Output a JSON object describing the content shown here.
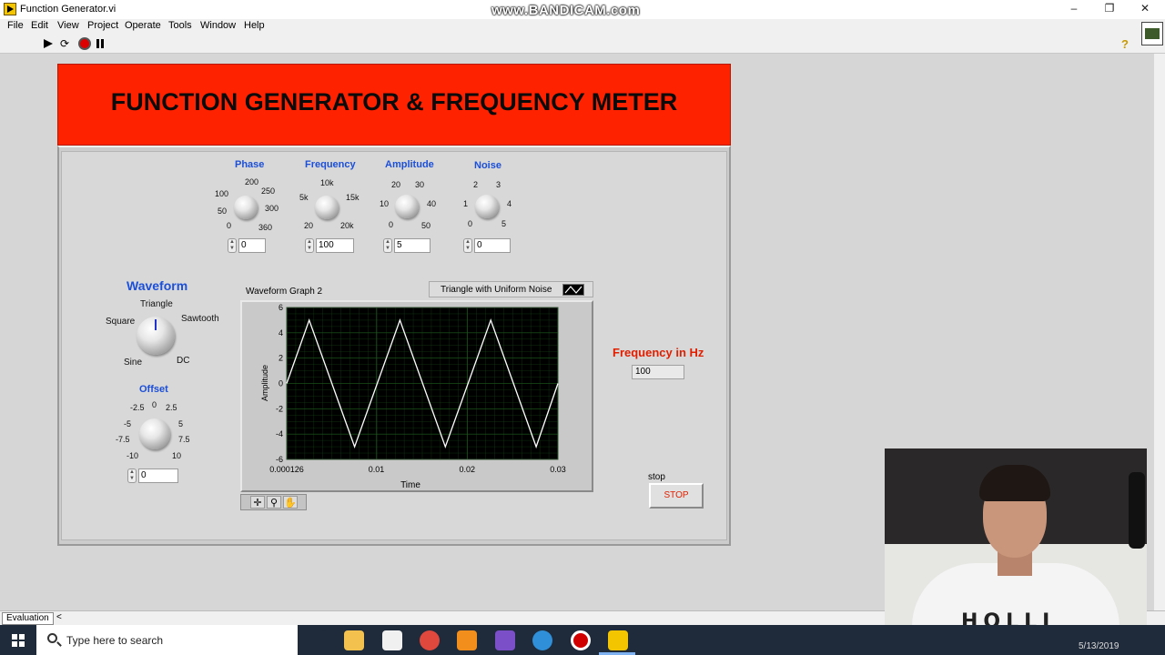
{
  "window": {
    "title": "Function Generator.vi",
    "watermark": "www.BANDICAM.com",
    "controls": [
      "–",
      "❐",
      "✕"
    ]
  },
  "menu": [
    "File",
    "Edit",
    "View",
    "Project",
    "Operate",
    "Tools",
    "Window",
    "Help"
  ],
  "toolbar": {
    "icons": [
      "run-arrow-icon",
      "run-continuously-icon",
      "abort-icon",
      "pause-icon"
    ],
    "help_icon": "?"
  },
  "panel": {
    "header_title": "FUNCTION GENERATOR & FREQUENCY METER",
    "header_color": "#ff2200",
    "knobs": {
      "phase": {
        "label": "Phase",
        "ticks": [
          "0",
          "50",
          "100",
          "200",
          "250",
          "300",
          "360"
        ],
        "value": "0"
      },
      "frequency": {
        "label": "Frequency",
        "ticks": [
          "20",
          "5k",
          "10k",
          "15k",
          "20k"
        ],
        "value": "100"
      },
      "amplitude": {
        "label": "Amplitude",
        "ticks": [
          "0",
          "10",
          "20",
          "30",
          "40",
          "50"
        ],
        "value": "5"
      },
      "noise": {
        "label": "Noise",
        "ticks": [
          "0",
          "1",
          "2",
          "3",
          "4",
          "5"
        ],
        "value": "0"
      }
    },
    "waveform": {
      "label": "Waveform",
      "options": [
        "Sine",
        "Square",
        "Triangle",
        "Sawtooth",
        "DC"
      ],
      "selected": "Triangle"
    },
    "offset": {
      "label": "Offset",
      "ticks": [
        "-10",
        "-7.5",
        "-5",
        "-2.5",
        "0",
        "2.5",
        "5",
        "7.5",
        "10"
      ],
      "value": "0"
    },
    "graph": {
      "caption": "Waveform Graph 2",
      "legend": "Triangle with Uniform Noise",
      "palette_icons": [
        "cursor-icon",
        "zoom-icon",
        "pan-hand-icon"
      ]
    },
    "frequency_indicator": {
      "label": "Frequency in Hz",
      "value": "100"
    },
    "stop": {
      "label": "stop",
      "button": "STOP"
    }
  },
  "chart_data": {
    "type": "line",
    "xlabel": "Time",
    "ylabel": "Amplitude",
    "xlim": [
      0.000126,
      0.03
    ],
    "ylim": [
      -6,
      6
    ],
    "x_ticks": [
      "0.000126",
      "0.01",
      "0.02",
      "0.03"
    ],
    "y_ticks": [
      "6",
      "4",
      "2",
      "0",
      "-2",
      "-4",
      "-6"
    ],
    "grid": true,
    "background": "#000000",
    "line_color": "#ffffff",
    "grid_color": "#1f5c1f",
    "series": [
      {
        "x": [
          0.000126,
          0.0026,
          0.0076,
          0.0126,
          0.0176,
          0.0226,
          0.0276,
          0.03
        ],
        "y": [
          0,
          5,
          -5,
          5,
          -5,
          5,
          -5,
          0
        ]
      }
    ]
  },
  "status": {
    "target": "Evaluation",
    "arrow": "<"
  },
  "taskbar": {
    "search_placeholder": "Type here to search",
    "date": "5/13/2019",
    "apps": [
      "task-view-icon",
      "file-explorer-icon",
      "store-icon",
      "chrome-icon",
      "sublime-icon",
      "visual-studio-icon",
      "browser-icon",
      "bandicam-record-icon",
      "labview-icon"
    ],
    "app_colors": [
      "#1f2a3a",
      "#f2c14e",
      "#f0f0f0",
      "#e0483e",
      "#f28f1c",
      "#7a4fc8",
      "#2f8fd8",
      "#d10000",
      "#f2c500"
    ]
  },
  "webcam": {
    "shirt_text": "HOLLI"
  }
}
